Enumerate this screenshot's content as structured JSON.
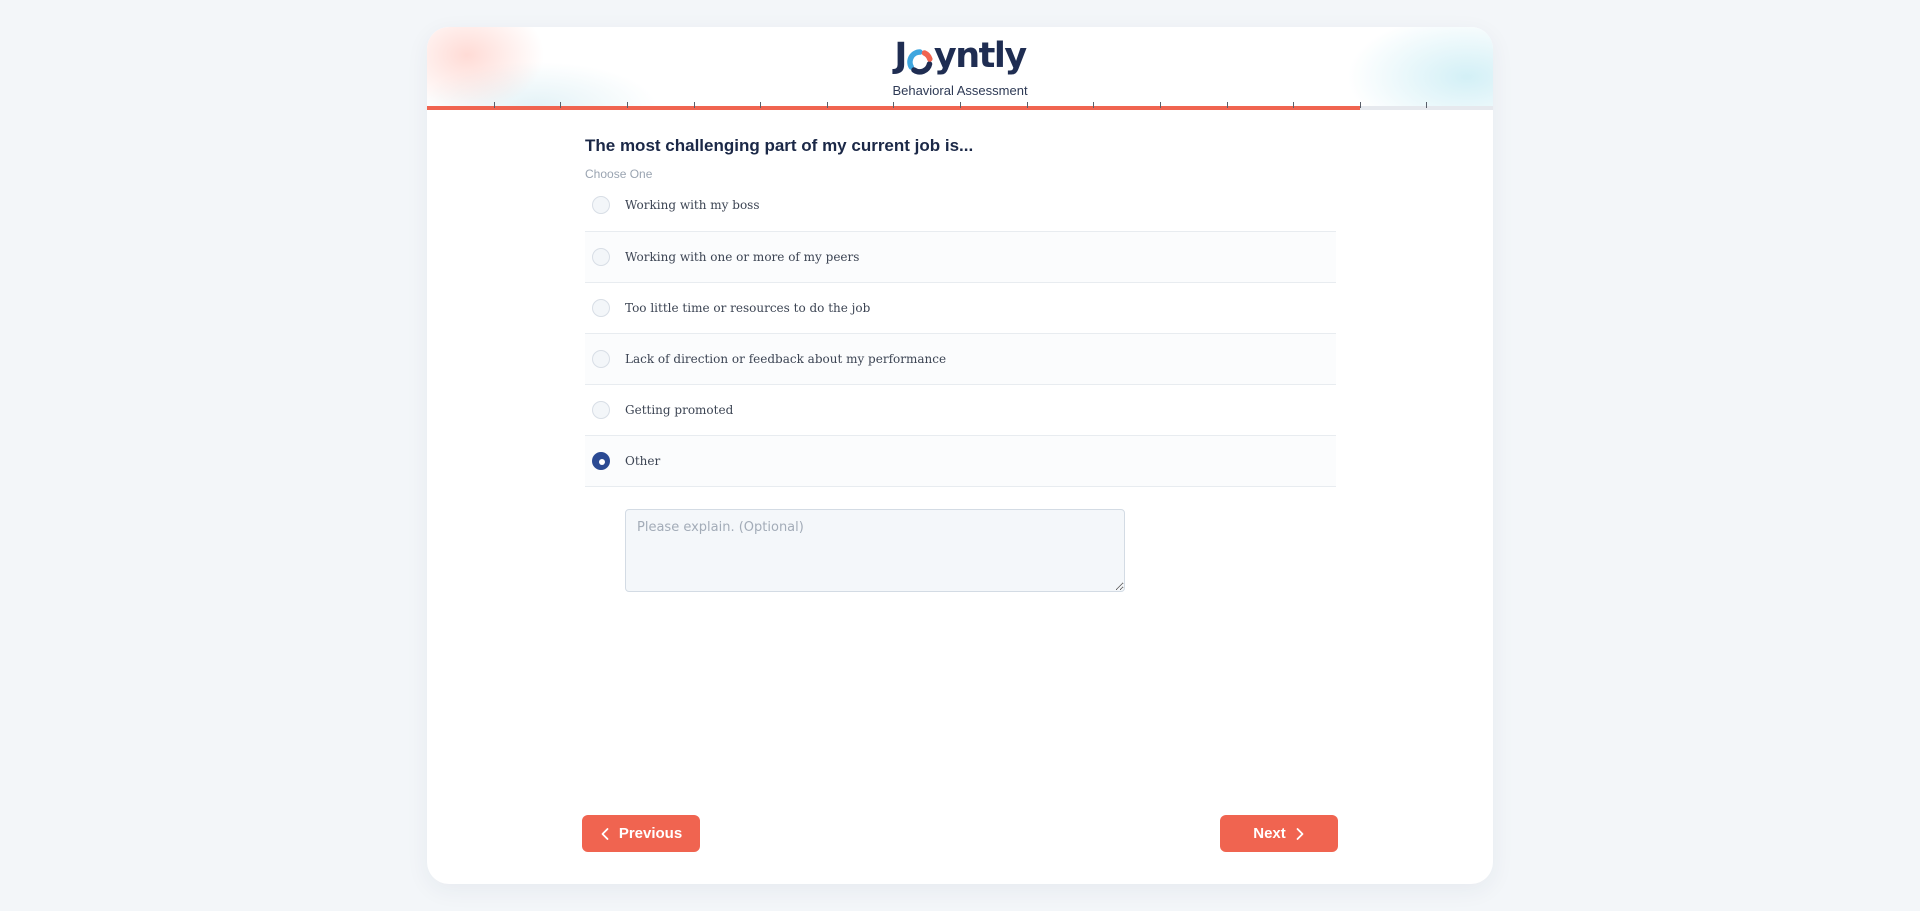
{
  "header": {
    "logo_left": "J",
    "logo_right": "yntly",
    "subtitle": "Behavioral Assessment",
    "progress": {
      "completed_steps": 14,
      "total_steps": 16,
      "fill_color": "#f06450",
      "track_color": "#e6e9ee"
    }
  },
  "question": {
    "title": "The most challenging part of my current job is...",
    "hint": "Choose One"
  },
  "options": [
    {
      "label": "Working with my boss",
      "selected": false
    },
    {
      "label": "Working with one or more of my peers",
      "selected": false
    },
    {
      "label": "Too little time or resources to do the job",
      "selected": false
    },
    {
      "label": "Lack of direction or feedback about my performance",
      "selected": false
    },
    {
      "label": "Getting promoted",
      "selected": false
    },
    {
      "label": "Other",
      "selected": true
    }
  ],
  "explain": {
    "placeholder": "Please explain. (Optional)",
    "value": ""
  },
  "nav": {
    "previous_label": "Previous",
    "next_label": "Next",
    "previous_icon": "chevron-left-icon",
    "next_icon": "chevron-right-icon"
  },
  "colors": {
    "accent": "#f06450",
    "selected_radio": "#2b4a93",
    "heading": "#1b2847",
    "background": "#f3f6f9"
  }
}
